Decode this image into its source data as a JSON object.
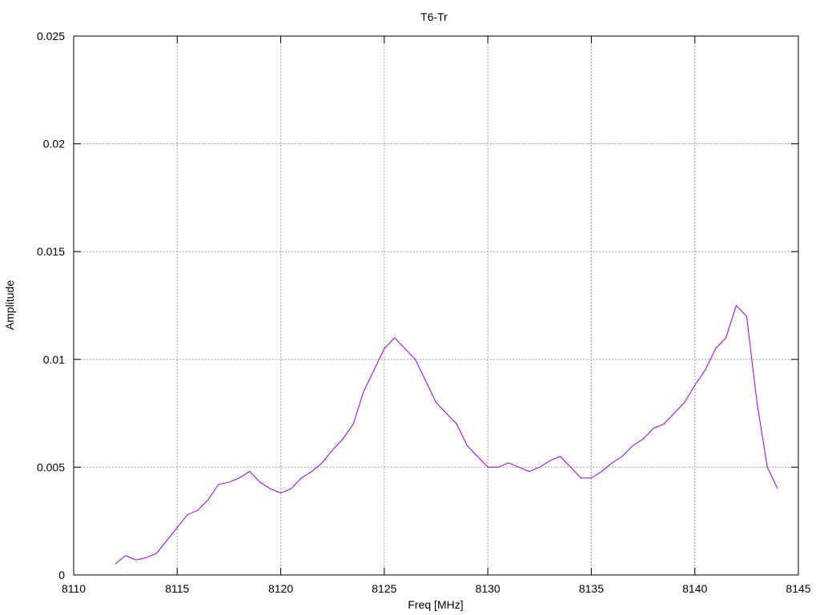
{
  "chart_data": {
    "type": "line",
    "title": "T6-Tr",
    "xlabel": "Freq [MHz]",
    "ylabel": "Amplitude",
    "xlim": [
      8110,
      8145
    ],
    "ylim": [
      0,
      0.025
    ],
    "xticks": [
      8110,
      8115,
      8120,
      8125,
      8130,
      8135,
      8140,
      8145
    ],
    "yticks": [
      0,
      0.005,
      0.01,
      0.015,
      0.02,
      0.025
    ],
    "xtick_labels": [
      "8110",
      "8115",
      "8120",
      "8125",
      "8130",
      "8135",
      "8140",
      "8145"
    ],
    "ytick_labels": [
      "0",
      "0.005",
      "0.01",
      "0.015",
      "0.02",
      "0.025"
    ],
    "grid": true,
    "legend": "none",
    "series": [
      {
        "color": "#9400d3",
        "x": [
          8112.0,
          8112.5,
          8113.0,
          8113.5,
          8114.0,
          8114.5,
          8115.0,
          8115.5,
          8116.0,
          8116.5,
          8117.0,
          8117.5,
          8118.0,
          8118.5,
          8119.0,
          8119.5,
          8120.0,
          8120.5,
          8121.0,
          8121.5,
          8122.0,
          8122.5,
          8123.0,
          8123.5,
          8124.0,
          8124.5,
          8125.0,
          8125.5,
          8126.0,
          8126.5,
          8127.0,
          8127.5,
          8128.0,
          8128.5,
          8129.0,
          8129.5,
          8130.0,
          8130.5,
          8131.0,
          8131.5,
          8132.0,
          8132.5,
          8133.0,
          8133.5,
          8134.0,
          8134.5,
          8135.0,
          8135.5,
          8136.0,
          8136.5,
          8137.0,
          8137.5,
          8138.0,
          8138.5,
          8139.0,
          8139.5,
          8140.0,
          8140.5,
          8141.0,
          8141.5,
          8142.0,
          8142.5,
          8143.0,
          8143.5,
          8144.0
        ],
        "y": [
          0.0005,
          0.0009,
          0.0007,
          0.0008,
          0.001,
          0.0016,
          0.0022,
          0.0028,
          0.003,
          0.0035,
          0.0042,
          0.0043,
          0.0045,
          0.0048,
          0.0043,
          0.004,
          0.0038,
          0.004,
          0.0045,
          0.0048,
          0.0052,
          0.0058,
          0.0063,
          0.007,
          0.0085,
          0.0095,
          0.0105,
          0.011,
          0.0105,
          0.01,
          0.009,
          0.008,
          0.0075,
          0.007,
          0.006,
          0.0055,
          0.005,
          0.005,
          0.0052,
          0.005,
          0.0048,
          0.005,
          0.0053,
          0.0055,
          0.005,
          0.0045,
          0.0045,
          0.0048,
          0.0052,
          0.0055,
          0.006,
          0.0063,
          0.0068,
          0.007,
          0.0075,
          0.008,
          0.0088,
          0.0095,
          0.0105,
          0.011,
          0.0125,
          0.012,
          0.008,
          0.005,
          0.004
        ]
      }
    ]
  }
}
